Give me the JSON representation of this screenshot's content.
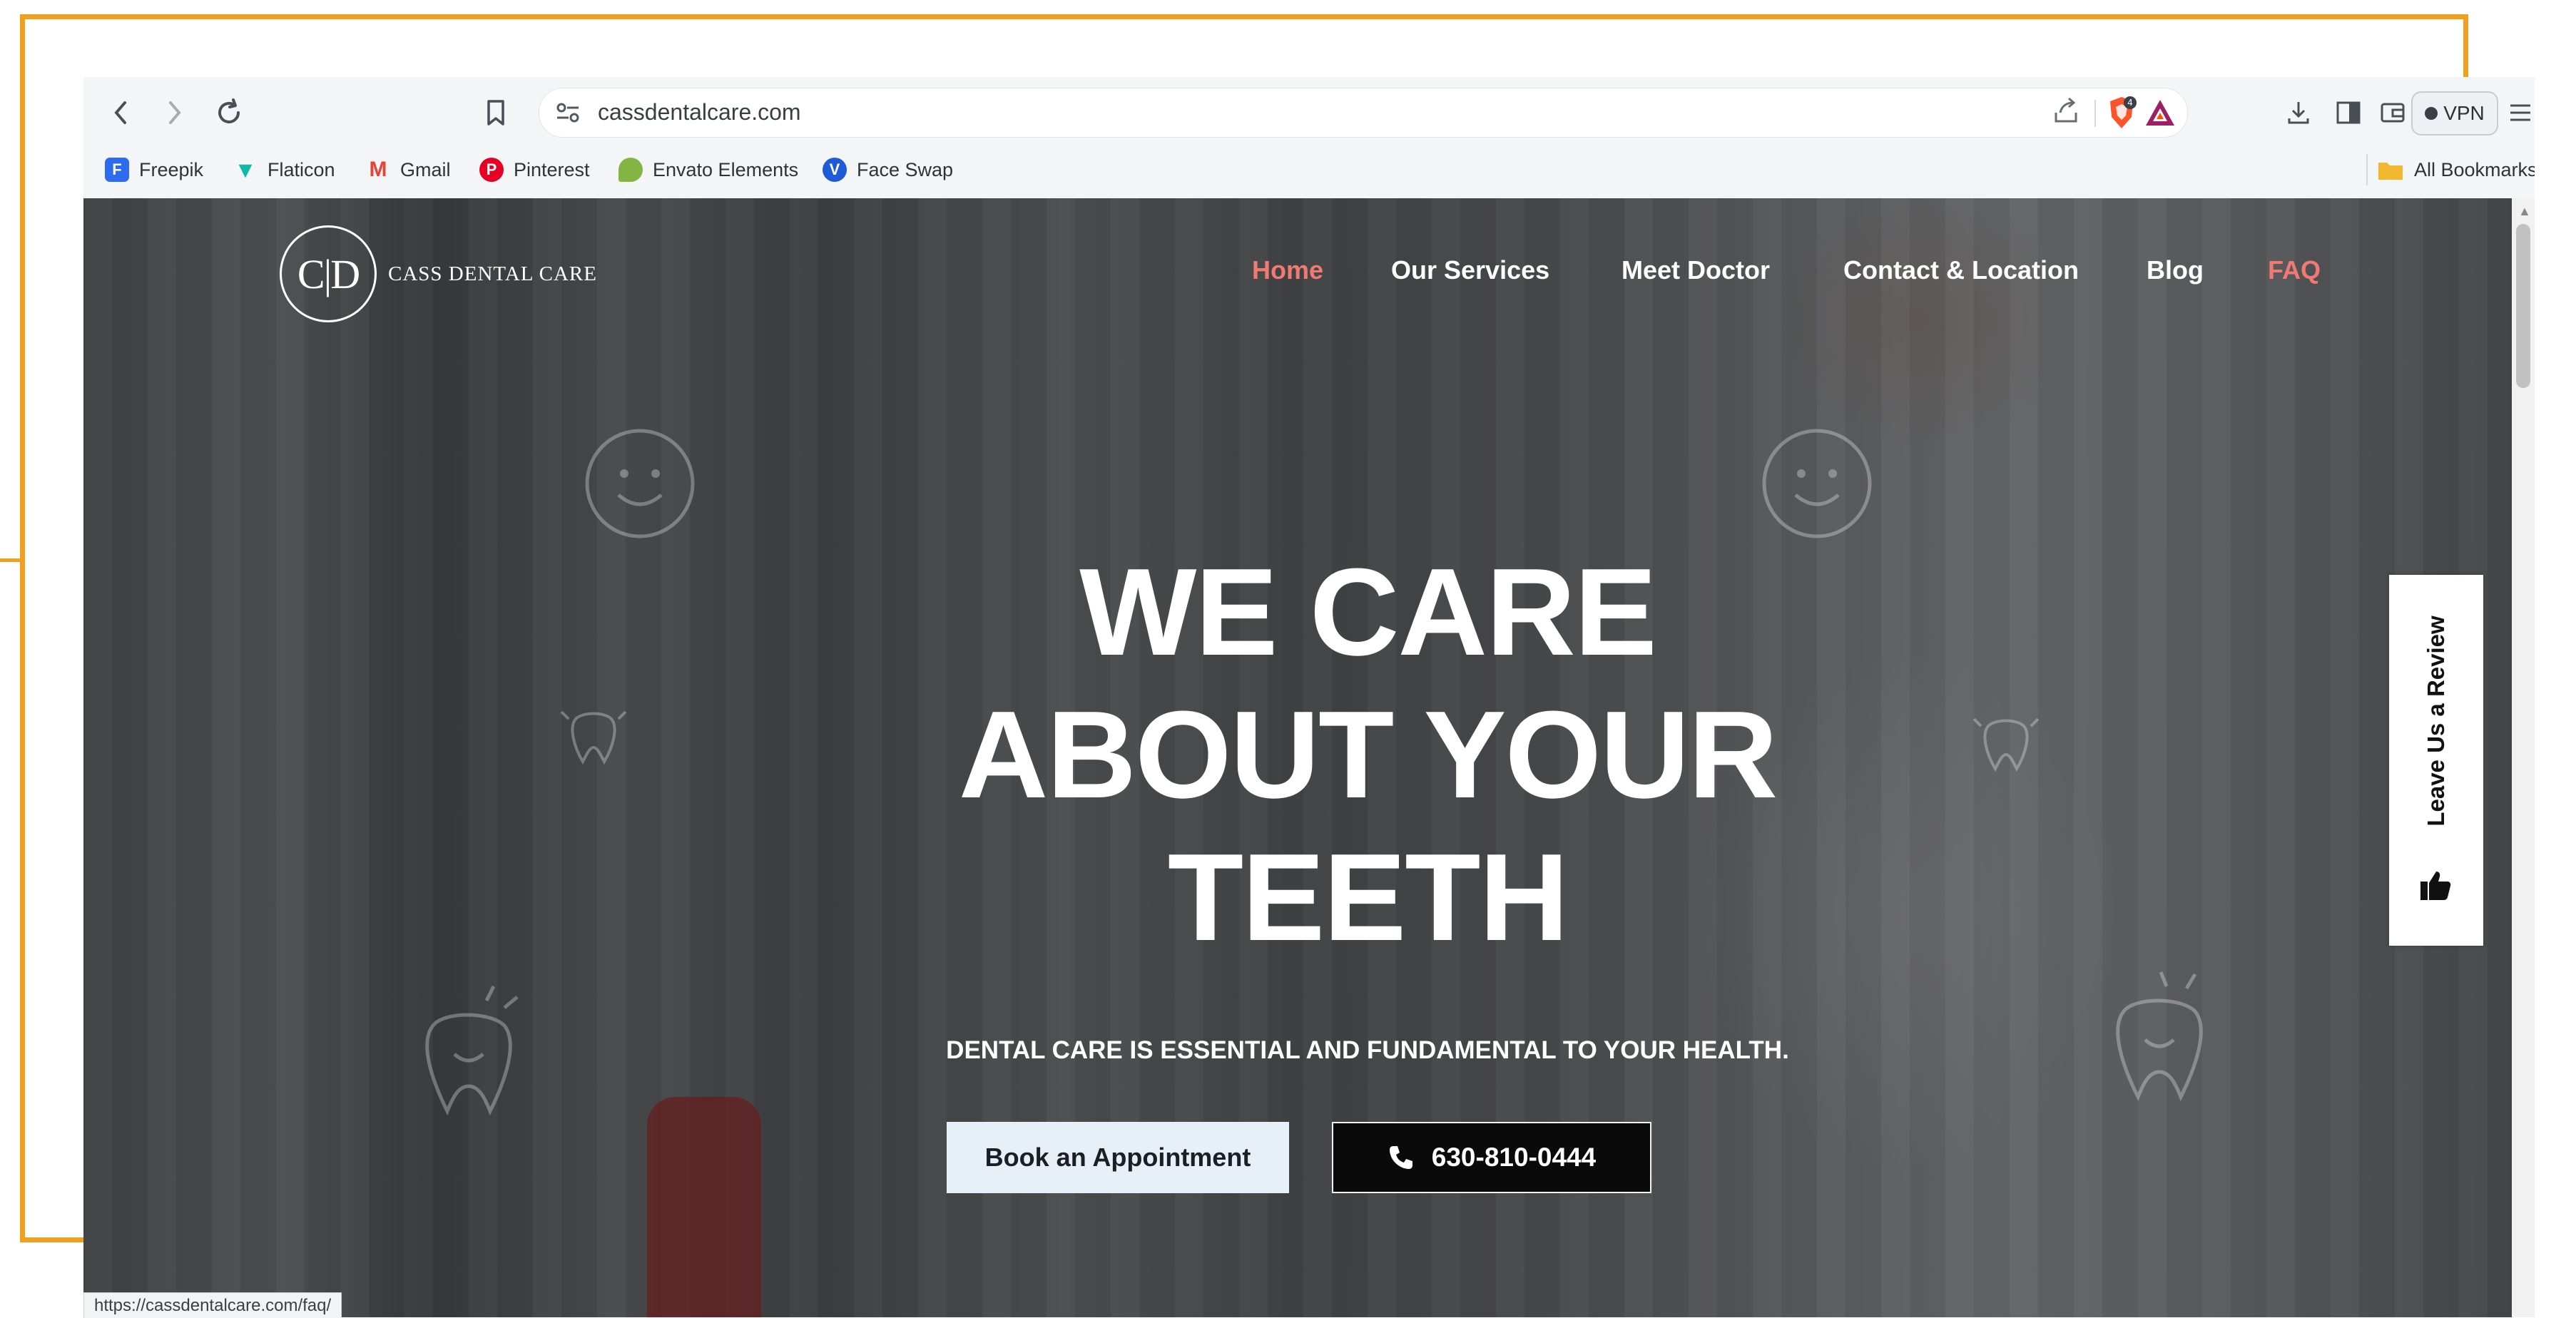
{
  "browser": {
    "url": "cassdentalcare.com",
    "status_url": "https://cassdentalcare.com/faq/",
    "vpn_label": "VPN",
    "brave_badge": "4",
    "bookmarks": [
      {
        "label": "Freepik",
        "icon": "freepik-icon",
        "color": "#2d6cf0"
      },
      {
        "label": "Flaticon",
        "icon": "flaticon-icon",
        "color": "#10b8a8"
      },
      {
        "label": "Gmail",
        "icon": "gmail-icon",
        "color": "#ea4335"
      },
      {
        "label": "Pinterest",
        "icon": "pinterest-icon",
        "color": "#e60023"
      },
      {
        "label": "Envato Elements",
        "icon": "envato-icon",
        "color": "#82b541"
      },
      {
        "label": "Face Swap",
        "icon": "faceswap-icon",
        "color": "#1e5bd8"
      }
    ],
    "all_bookmarks_label": "All Bookmarks"
  },
  "site": {
    "logo_initials": "C|D",
    "logo_name": "CASS DENTAL CARE",
    "nav": [
      {
        "label": "Home",
        "color": "#f07a73"
      },
      {
        "label": "Our Services",
        "color": "#ffffff"
      },
      {
        "label": "Meet Doctor",
        "color": "#ffffff"
      },
      {
        "label": "Contact & Location",
        "color": "#ffffff"
      },
      {
        "label": "Blog",
        "color": "#ffffff"
      },
      {
        "label": "FAQ",
        "color": "#f07a73"
      }
    ],
    "headline_line1": "WE CARE",
    "headline_line2": "ABOUT YOUR",
    "headline_line3": "TEETH",
    "tagline": "DENTAL CARE IS ESSENTIAL AND FUNDAMENTAL TO YOUR HEALTH.",
    "book_button": "Book an Appointment",
    "phone_button": "630-810-0444",
    "review_tab": "Leave Us a Review"
  },
  "colors": {
    "frame_accent": "#f0a01e",
    "nav_active": "#f07a73"
  }
}
